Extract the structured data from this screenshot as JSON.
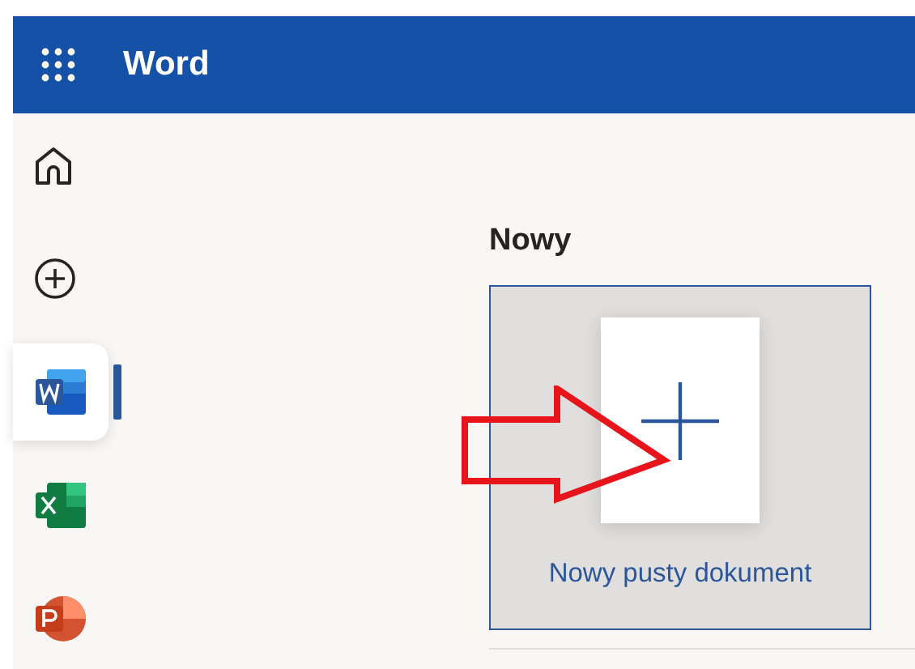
{
  "header": {
    "app_title": "Word"
  },
  "sidebar": {
    "items": [
      {
        "kind": "home",
        "selected": false
      },
      {
        "kind": "create",
        "selected": false
      },
      {
        "kind": "word",
        "selected": true
      },
      {
        "kind": "excel",
        "selected": false
      },
      {
        "kind": "powerpoint",
        "selected": false
      }
    ]
  },
  "main": {
    "section_title": "Nowy",
    "templates": [
      {
        "label": "Nowy pusty dokument"
      }
    ],
    "annotation": {
      "kind": "arrow"
    }
  }
}
